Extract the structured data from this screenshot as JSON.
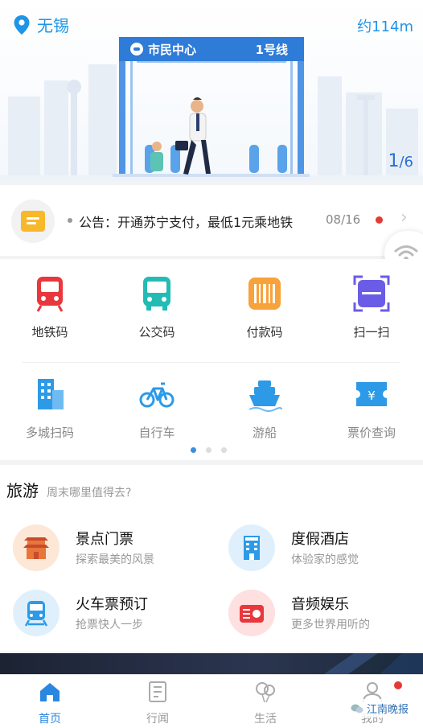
{
  "header": {
    "city": "无锡",
    "distance": "约114m",
    "pager_current": "1",
    "pager_total": "/6"
  },
  "banner": {
    "station_name": "市民中心",
    "line_label": "1号线"
  },
  "notice": {
    "text": "公告：开通苏宁支付，最低1元乘地铁",
    "date": "08/16"
  },
  "grid": {
    "row1": [
      {
        "label": "地铁码",
        "icon": "metro-icon"
      },
      {
        "label": "公交码",
        "icon": "bus-icon"
      },
      {
        "label": "付款码",
        "icon": "barcode-icon"
      },
      {
        "label": "扫一扫",
        "icon": "scan-icon"
      }
    ],
    "row2": [
      {
        "label": "多城扫码",
        "icon": "building-icon"
      },
      {
        "label": "自行车",
        "icon": "bicycle-icon"
      },
      {
        "label": "游船",
        "icon": "boat-icon"
      },
      {
        "label": "票价查询",
        "icon": "ticket-icon"
      }
    ]
  },
  "travel": {
    "title": "旅游",
    "subtitle": "周末哪里值得去?",
    "items": [
      {
        "name": "景点门票",
        "desc": "探索最美的风景",
        "icon": "pagoda-icon"
      },
      {
        "name": "度假酒店",
        "desc": "体验家的感觉",
        "icon": "hotel-icon"
      },
      {
        "name": "火车票预订",
        "desc": "抢票快人一步",
        "icon": "train-icon"
      },
      {
        "name": "音频娱乐",
        "desc": "更多世界用听的",
        "icon": "radio-icon"
      }
    ]
  },
  "nav": {
    "items": [
      {
        "label": "首页",
        "icon": "home-icon",
        "active": true
      },
      {
        "label": "行闻",
        "icon": "news-icon",
        "active": false
      },
      {
        "label": "生活",
        "icon": "balloon-icon",
        "active": false
      },
      {
        "label": "我的",
        "icon": "user-icon",
        "active": false
      }
    ]
  },
  "watermark": "江南晚报",
  "colors": {
    "accent": "#1f95e8",
    "nav_active": "#2a87e0",
    "alert": "#e53935"
  }
}
